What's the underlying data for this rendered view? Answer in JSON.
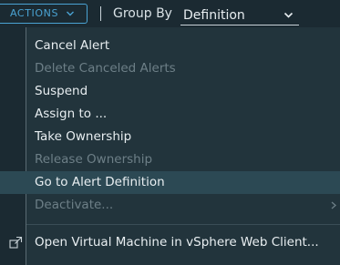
{
  "toolbar": {
    "actions_label": "ACTIONS",
    "group_by_label": "Group By",
    "group_by_value": "Definition"
  },
  "menu": {
    "items": [
      {
        "label": "Cancel Alert",
        "enabled": true
      },
      {
        "label": "Delete Canceled Alerts",
        "enabled": false
      },
      {
        "label": "Suspend",
        "enabled": true
      },
      {
        "label": "Assign to ...",
        "enabled": true
      },
      {
        "label": "Take Ownership",
        "enabled": true
      },
      {
        "label": "Release Ownership",
        "enabled": false
      },
      {
        "label": "Go to Alert Definition",
        "enabled": true,
        "highlighted": true
      },
      {
        "label": "Deactivate...",
        "enabled": false,
        "has_submenu": true
      },
      {
        "label": "Open Virtual Machine in vSphere Web Client...",
        "enabled": true,
        "icon": "external-link-icon"
      }
    ]
  },
  "colors": {
    "background": "#1b2a32",
    "menu_background": "#22343c",
    "accent": "#4aa3d3",
    "highlight": "#2c4954",
    "disabled_text": "#6d7f87"
  }
}
